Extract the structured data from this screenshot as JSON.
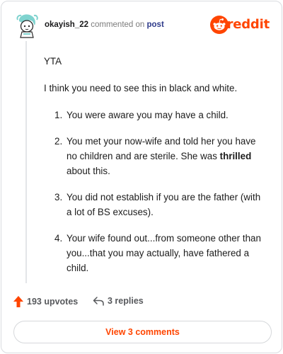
{
  "header": {
    "username": "okayish_22",
    "commented_text": "commented on",
    "post_link": "post",
    "brand": "reddit"
  },
  "comment": {
    "verdict": "YTA",
    "intro": "I think you need to see this in black and white.",
    "points": [
      {
        "num": "1.",
        "text": "You were aware you may have a child."
      },
      {
        "num": "2.",
        "pre": "You met your now-wife and told her you have no children and are sterile. She was ",
        "bold": "thrilled",
        "post": " about this."
      },
      {
        "num": "3.",
        "text": "You did not establish if you are the father (with a lot of BS excuses)."
      },
      {
        "num": "4.",
        "text": "Your wife found out...from someone other than you...that you may actually, have fathered a child."
      }
    ]
  },
  "footer": {
    "upvotes": "193 upvotes",
    "replies": "3 replies",
    "view_comments": "View 3 comments"
  },
  "colors": {
    "brand": "#ff4500",
    "link": "#2e3a8a",
    "muted": "#7c7c7c"
  },
  "icons": [
    "avatar",
    "reddit-logo-icon",
    "upvote-arrow-icon",
    "reply-icon"
  ]
}
